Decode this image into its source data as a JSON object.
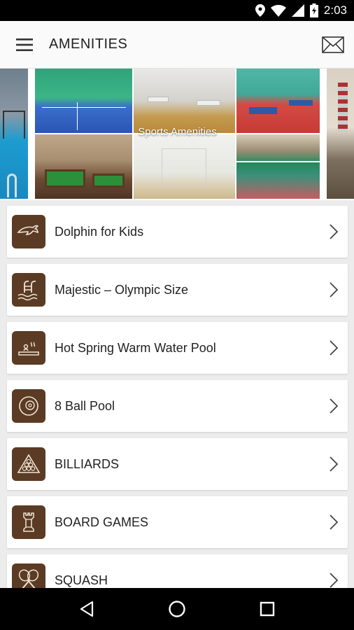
{
  "status_bar": {
    "time": "2:03",
    "icons": [
      "location-icon",
      "wifi-icon",
      "signal-icon",
      "battery-icon"
    ]
  },
  "app_bar": {
    "title": "AMENITIES",
    "menu_icon": "hamburger-menu-icon",
    "action_icon": "mail-icon"
  },
  "carousel": {
    "caption": "Sports Amenities"
  },
  "amenities": [
    {
      "label": "Dolphin for Kids",
      "icon": "dolphin-icon"
    },
    {
      "label": "Majestic – Olympic Size",
      "icon": "pool-ladder-icon"
    },
    {
      "label": "Hot Spring Warm Water Pool",
      "icon": "warm-pool-icon"
    },
    {
      "label": "8 Ball Pool",
      "icon": "eight-ball-icon"
    },
    {
      "label": "BILLIARDS",
      "icon": "billiard-rack-icon"
    },
    {
      "label": "BOARD GAMES",
      "icon": "chess-rook-icon"
    },
    {
      "label": "SQUASH",
      "icon": "squash-rackets-icon"
    }
  ],
  "nav_bar": {
    "icons": [
      "back-icon",
      "home-icon",
      "recents-icon"
    ]
  },
  "colors": {
    "icon_bg": "#5b3b24",
    "status_bar": "#000000",
    "app_bar": "#fafafa",
    "list_bg": "#ececec"
  }
}
